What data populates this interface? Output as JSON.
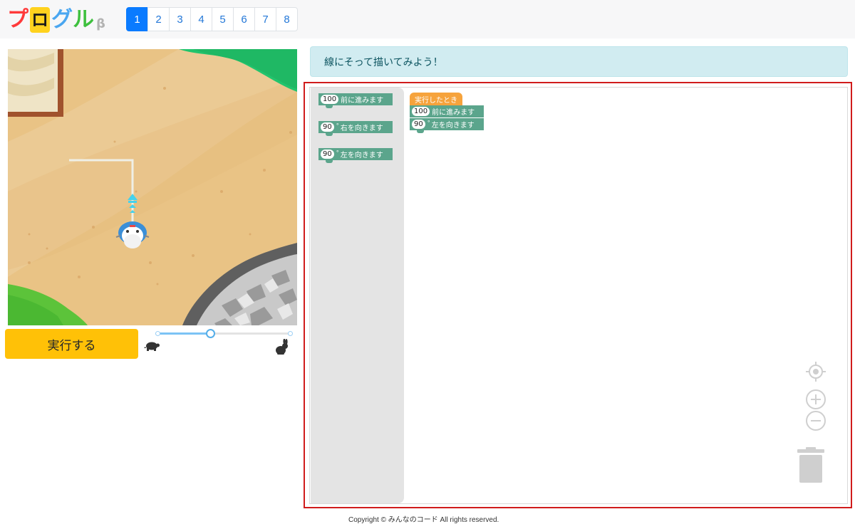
{
  "header": {
    "logo": {
      "chars": [
        "プ",
        "ロ",
        "グ",
        "ル"
      ],
      "colors": [
        "#ff3a3a",
        "#ffd21e",
        "#4aa6f0",
        "#3ec03e"
      ],
      "beta": "β"
    },
    "pages": [
      "1",
      "2",
      "3",
      "4",
      "5",
      "6",
      "7",
      "8"
    ],
    "active_page": "1"
  },
  "stage": {
    "speed_fraction": 0.4
  },
  "controls": {
    "run_label": "実行する",
    "slow_icon": "turtle-icon",
    "fast_icon": "rabbit-icon"
  },
  "instruction": "線にそって描いてみよう！",
  "toolbox": {
    "blocks": [
      {
        "num": "100",
        "label": "前に進みます"
      },
      {
        "num": "90",
        "deg": "°",
        "label": "右を向きます"
      },
      {
        "num": "90",
        "deg": "°",
        "label": "左を向きます"
      }
    ]
  },
  "program": {
    "hat_label": "実行したとき",
    "blocks": [
      {
        "num": "100",
        "label": "前に進みます"
      },
      {
        "num": "90",
        "deg": "°",
        "label": "左を向きます"
      }
    ]
  },
  "workspace_icons": [
    "target-icon",
    "zoom-in-icon",
    "zoom-out-icon",
    "trash-icon"
  ],
  "colors": {
    "block_green": "#5ba58c",
    "hat_orange": "#f6a33c",
    "run_yellow": "#ffc107",
    "frame_red": "#d01c1c"
  },
  "footer": "Copyright © みんなのコード All rights reserved."
}
